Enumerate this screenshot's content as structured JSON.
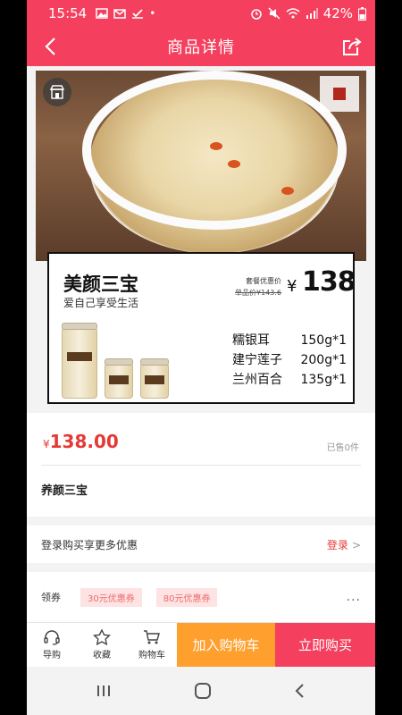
{
  "status_bar": {
    "time": "15:54",
    "battery": "42%"
  },
  "header": {
    "title": "商品详情"
  },
  "image_card": {
    "title": "美颜三宝",
    "subtitle": "爱自己享受生活",
    "promo_label": "套餐优惠价",
    "original_label": "单品价¥143.6",
    "currency": "¥",
    "price": "138",
    "items": [
      {
        "name": "糯银耳",
        "qty": "150g*1"
      },
      {
        "name": "建宁莲子",
        "qty": "200g*1"
      },
      {
        "name": "兰州百合",
        "qty": "135g*1"
      }
    ]
  },
  "price_section": {
    "currency": "¥",
    "price": "138.00",
    "sold": "已售0件",
    "product_name": "养颜三宝"
  },
  "login": {
    "text": "登录购买享更多优惠",
    "link": "登录",
    "arrow": ">"
  },
  "coupons": {
    "label": "领券",
    "items": [
      "30元优惠券",
      "80元优惠券"
    ],
    "more": "..."
  },
  "bottom_bar": {
    "guide": "导购",
    "favorite": "收藏",
    "cart": "购物车",
    "add_to_cart": "加入购物车",
    "buy_now": "立即购买"
  },
  "colors": {
    "brand_red": "#f43f5e",
    "price_red": "#e53935",
    "cart_orange": "#ff9f2e"
  }
}
